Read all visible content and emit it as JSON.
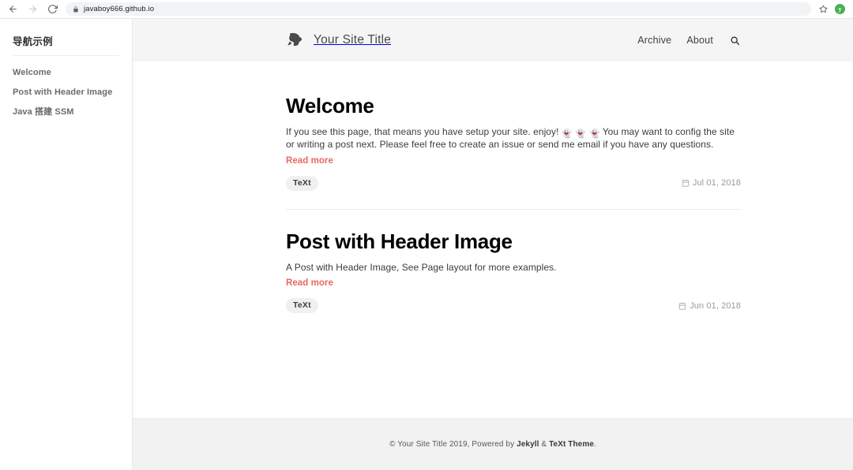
{
  "browser": {
    "back_icon": "arrow-left-icon",
    "forward_icon": "arrow-right-icon",
    "reload_icon": "reload-icon",
    "lock_icon": "lock-icon",
    "url": "javaboy666.github.io",
    "bookmark_icon": "star-icon",
    "profile_initial": "y"
  },
  "sidebar": {
    "title": "导航示例",
    "items": [
      {
        "label": "Welcome"
      },
      {
        "label": "Post with Header Image"
      },
      {
        "label": "Java 搭建 SSM"
      }
    ]
  },
  "header": {
    "logo_icon": "site-logo-icon",
    "site_title": "Your Site Title",
    "nav": [
      {
        "label": "Archive"
      },
      {
        "label": "About"
      }
    ],
    "search_icon": "search-icon"
  },
  "main": {
    "posts": [
      {
        "title": "Welcome",
        "excerpt_before": "If you see this page, that means you have setup your site. enjoy!",
        "emojis": [
          "👻",
          "👻",
          "👻"
        ],
        "excerpt_after": "You may want to config the site or writing a post next. Please feel free to create an issue or send me email if you have any questions.",
        "read_more": "Read more",
        "tag": "TeXt",
        "date": "Jul 01, 2018",
        "date_icon": "calendar-icon"
      },
      {
        "title": "Post with Header Image",
        "excerpt_before": "A Post with Header Image, See Page layout for more examples.",
        "emojis": [],
        "excerpt_after": "",
        "read_more": "Read more",
        "tag": "TeXt",
        "date": "Jun 01, 2018",
        "date_icon": "calendar-icon"
      }
    ]
  },
  "footer": {
    "copyright": "© Your Site Title 2019, Powered by",
    "jekyll": "Jekyll",
    "amp": "&",
    "theme": "TeXt Theme",
    "period": "."
  },
  "colors": {
    "accent": "#e8695d",
    "header_bg": "#f5f5f5",
    "footer_bg": "#f2f2f2",
    "tag_bg": "#f0f0f0"
  }
}
